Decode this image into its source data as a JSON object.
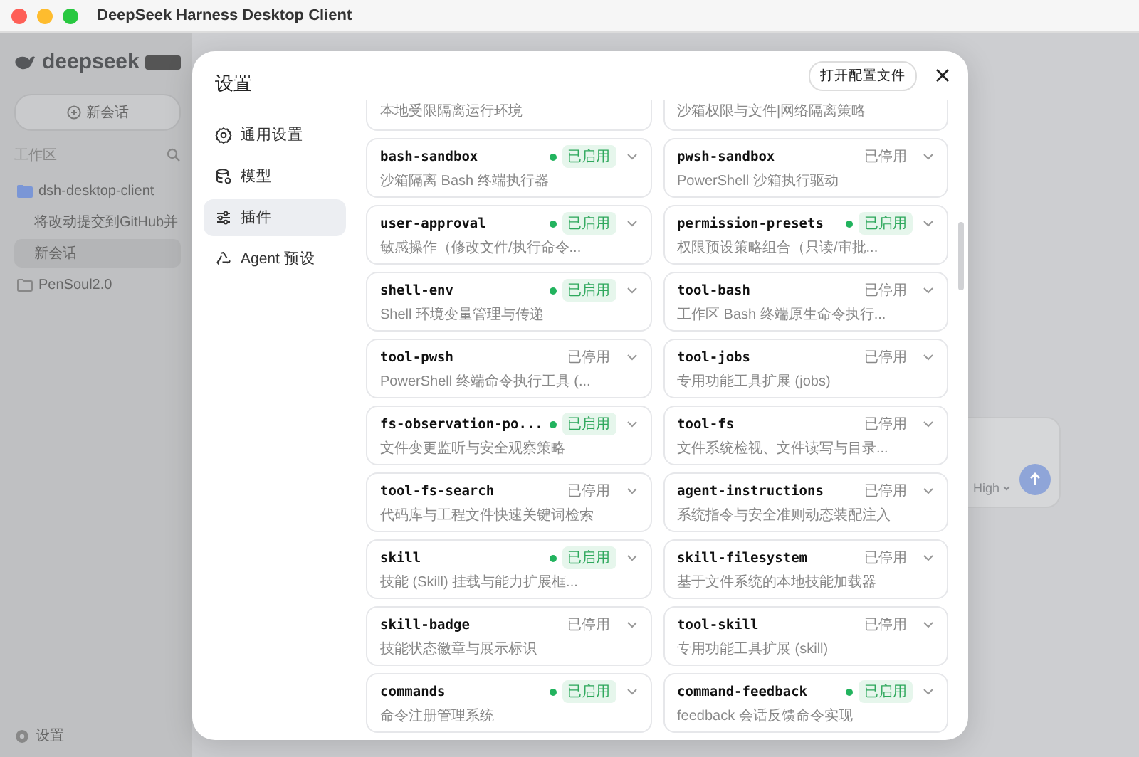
{
  "window": {
    "title": "DeepSeek Harness Desktop Client"
  },
  "sidebar": {
    "logo": "deepseek",
    "new_chat": "新会话",
    "workspace_label": "工作区",
    "tree": [
      {
        "label": "dsh-desktop-client",
        "expanded": true,
        "children": [
          {
            "label": "将改动提交到GitHub并",
            "selected": false
          },
          {
            "label": "新会话",
            "selected": true
          }
        ]
      },
      {
        "label": "PenSoul2.0",
        "expanded": false
      }
    ],
    "settings": "设置"
  },
  "composer": {
    "effort": "High"
  },
  "settings_dialog": {
    "title": "设置",
    "open_config": "打开配置文件",
    "nav": [
      {
        "label": "通用设置",
        "kind": "gear",
        "selected": false
      },
      {
        "label": "模型",
        "kind": "model",
        "selected": false
      },
      {
        "label": "插件",
        "kind": "sliders",
        "selected": true
      },
      {
        "label": "Agent 预设",
        "kind": "agent",
        "selected": false
      }
    ],
    "partial_row": [
      "本地受限隔离运行环境",
      "沙箱权限与文件|网络隔离策略"
    ],
    "plugins": [
      {
        "name": "bash-sandbox",
        "description": "沙箱隔离 Bash 终端执行器",
        "enabled": true,
        "status": "已启用"
      },
      {
        "name": "pwsh-sandbox",
        "description": "PowerShell 沙箱执行驱动",
        "enabled": false,
        "status": "已停用"
      },
      {
        "name": "user-approval",
        "description": "敏感操作（修改文件/执行命令...",
        "enabled": true,
        "status": "已启用"
      },
      {
        "name": "permission-presets",
        "description": "权限预设策略组合（只读/审批...",
        "enabled": true,
        "status": "已启用"
      },
      {
        "name": "shell-env",
        "description": "Shell 环境变量管理与传递",
        "enabled": true,
        "status": "已启用"
      },
      {
        "name": "tool-bash",
        "description": "工作区 Bash 终端原生命令执行...",
        "enabled": false,
        "status": "已停用"
      },
      {
        "name": "tool-pwsh",
        "description": "PowerShell 终端命令执行工具 (...",
        "enabled": false,
        "status": "已停用"
      },
      {
        "name": "tool-jobs",
        "description": "专用功能工具扩展 (jobs)",
        "enabled": false,
        "status": "已停用"
      },
      {
        "name": "fs-observation-po...",
        "description": "文件变更监听与安全观察策略",
        "enabled": true,
        "status": "已启用"
      },
      {
        "name": "tool-fs",
        "description": "文件系统检视、文件读写与目录...",
        "enabled": false,
        "status": "已停用"
      },
      {
        "name": "tool-fs-search",
        "description": "代码库与工程文件快速关键词检索",
        "enabled": false,
        "status": "已停用"
      },
      {
        "name": "agent-instructions",
        "description": "系统指令与安全准则动态装配注入",
        "enabled": false,
        "status": "已停用"
      },
      {
        "name": "skill",
        "description": "技能 (Skill) 挂载与能力扩展框...",
        "enabled": true,
        "status": "已启用"
      },
      {
        "name": "skill-filesystem",
        "description": "基于文件系统的本地技能加载器",
        "enabled": false,
        "status": "已停用"
      },
      {
        "name": "skill-badge",
        "description": "技能状态徽章与展示标识",
        "enabled": false,
        "status": "已停用"
      },
      {
        "name": "tool-skill",
        "description": "专用功能工具扩展 (skill)",
        "enabled": false,
        "status": "已停用"
      },
      {
        "name": "commands",
        "description": "命令注册管理系统",
        "enabled": true,
        "status": "已启用"
      },
      {
        "name": "command-feedback",
        "description": "feedback 会话反馈命令实现",
        "enabled": true,
        "status": "已启用"
      }
    ]
  }
}
